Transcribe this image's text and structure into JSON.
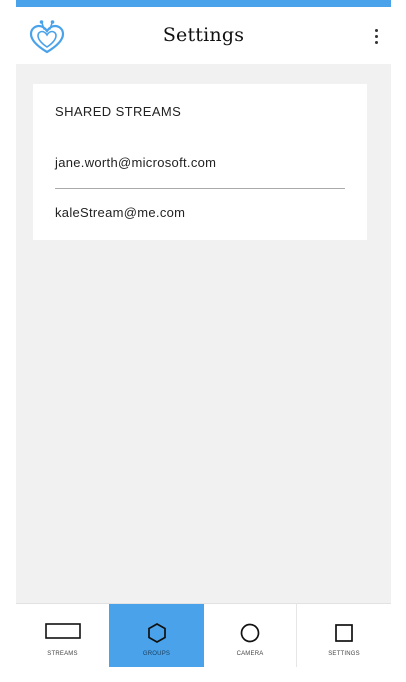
{
  "header": {
    "title": "Settings",
    "logo_icon": "app-logo-heart-bee",
    "menu_icon": "more-vertical-icon"
  },
  "card": {
    "title": "SHARED STREAMS",
    "streams": [
      "jane.worth@microsoft.com",
      "kaleStream@me.com"
    ]
  },
  "nav": {
    "items": [
      {
        "label": "STREAMS",
        "icon": "rectangle-icon",
        "active": false
      },
      {
        "label": "GROUPS",
        "icon": "hexagon-icon",
        "active": true
      },
      {
        "label": "CAMERA",
        "icon": "circle-icon",
        "active": false
      },
      {
        "label": "SETTINGS",
        "icon": "square-icon",
        "active": false
      }
    ]
  },
  "colors": {
    "accent": "#4aa3ea",
    "background": "#f1f1f1",
    "surface": "#ffffff"
  }
}
